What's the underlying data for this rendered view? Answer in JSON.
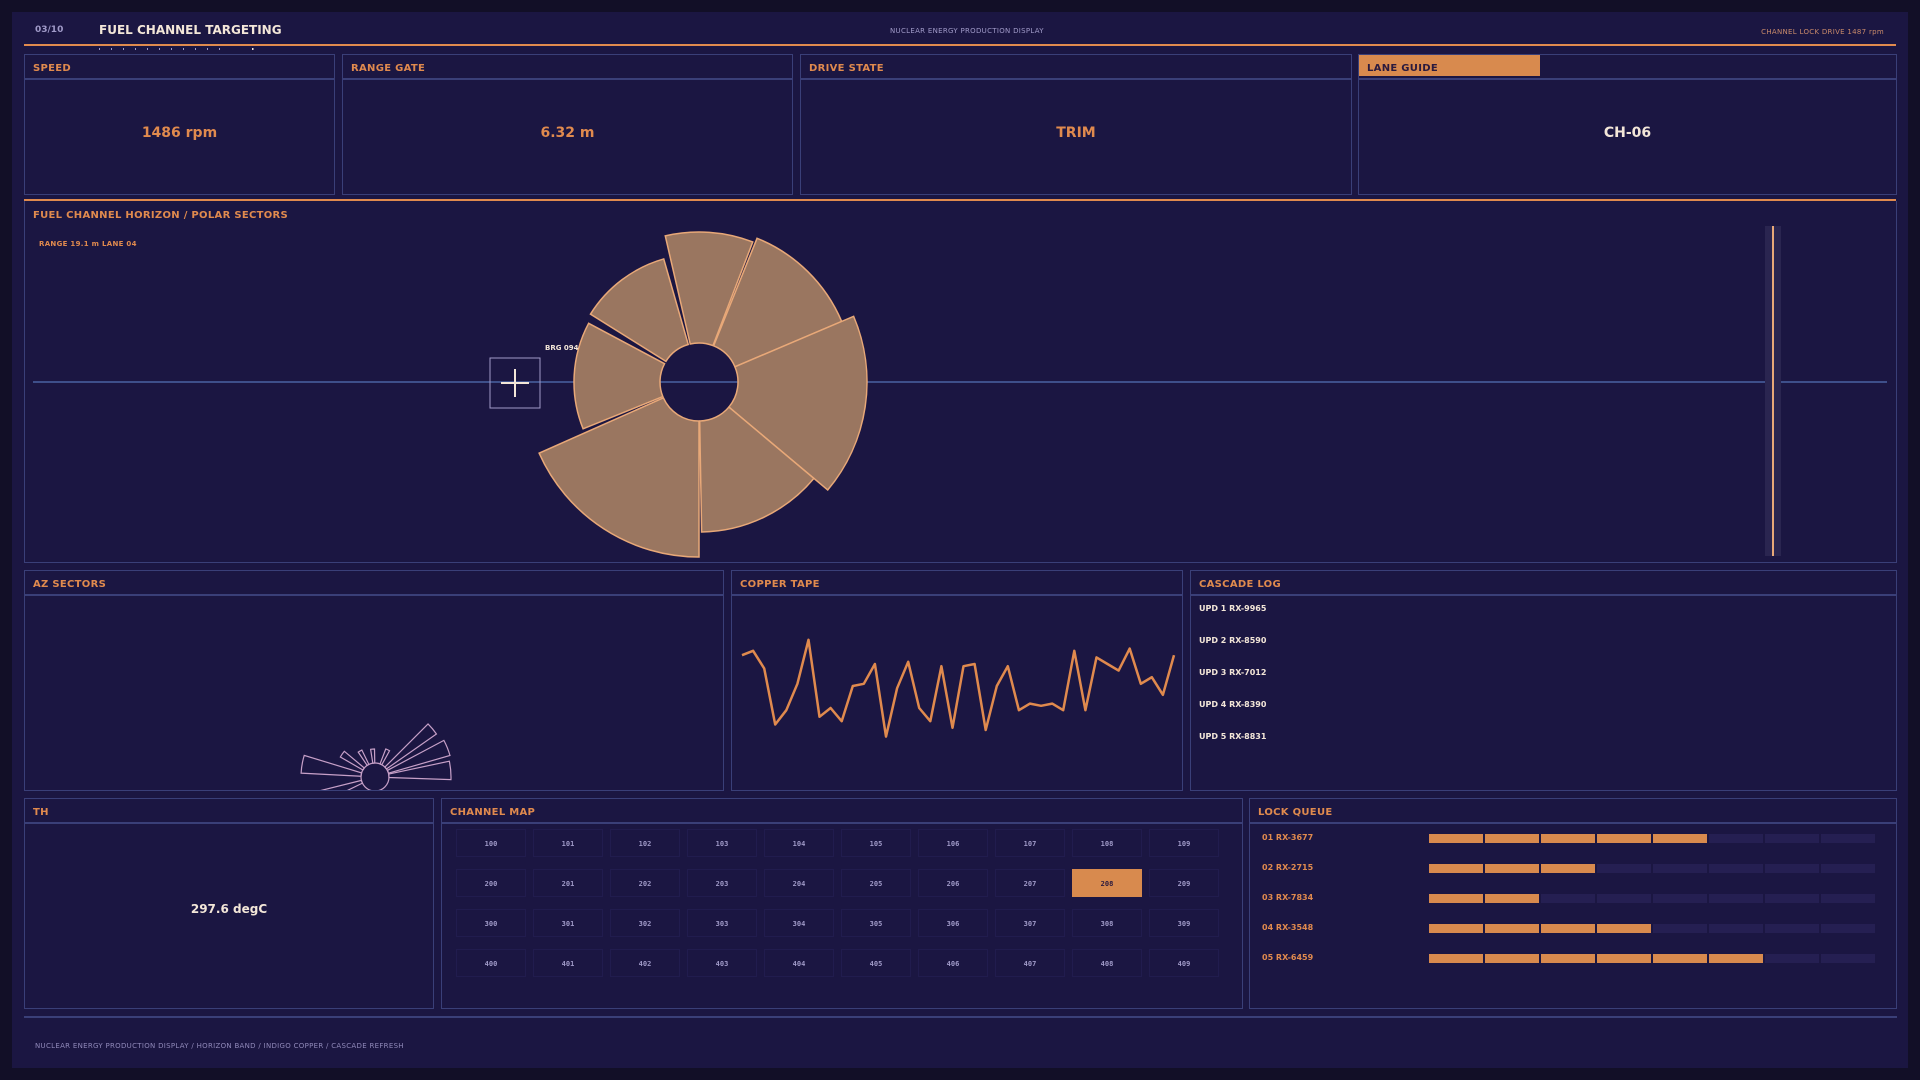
{
  "header": {
    "page_counter": "03/10",
    "title": "FUEL CHANNEL TARGETING",
    "subtitle": "NUCLEAR ENERGY PRODUCTION DISPLAY",
    "status": "CHANNEL LOCK  DRIVE 1487 rpm"
  },
  "stats": [
    {
      "label": "SPEED",
      "value": "1486 rpm",
      "color": "#e08a4e"
    },
    {
      "label": "RANGE GATE",
      "value": "6.32 m",
      "color": "#e08a4e"
    },
    {
      "label": "DRIVE STATE",
      "value": "TRIM",
      "color": "#e08a4e"
    },
    {
      "label": "LANE GUIDE",
      "value": "CH-06",
      "color": "#f3e6d8"
    }
  ],
  "horizon": {
    "title": "FUEL CHANNEL HORIZON  /  POLAR SECTORS",
    "range_readout": "RANGE 19.1 m  LANE 04",
    "bearing_label": "BRG 094"
  },
  "az_sectors": {
    "title": "AZ SECTORS"
  },
  "copper_tape": {
    "title": "COPPER TAPE",
    "values": [
      0.78,
      0.82,
      0.66,
      0.15,
      0.28,
      0.52,
      0.92,
      0.22,
      0.3,
      0.18,
      0.5,
      0.52,
      0.7,
      0.04,
      0.48,
      0.72,
      0.3,
      0.18,
      0.68,
      0.12,
      0.68,
      0.7,
      0.1,
      0.5,
      0.68,
      0.28,
      0.34,
      0.32,
      0.34,
      0.28,
      0.82,
      0.28,
      0.76,
      0.7,
      0.64,
      0.84,
      0.52,
      0.58,
      0.42,
      0.78
    ]
  },
  "cascade_log": {
    "title": "CASCADE LOG",
    "entries": [
      "UPD 1  RX-9965",
      "UPD 2  RX-8590",
      "UPD 3  RX-7012",
      "UPD 4  RX-8390",
      "UPD 5  RX-8831"
    ]
  },
  "th": {
    "title": "TH",
    "value": "297.6 degC"
  },
  "channel_map": {
    "title": "CHANNEL MAP",
    "rows": [
      [
        "100",
        "101",
        "102",
        "103",
        "104",
        "105",
        "106",
        "107",
        "108",
        "109"
      ],
      [
        "200",
        "201",
        "202",
        "203",
        "204",
        "205",
        "206",
        "207",
        "208",
        "209"
      ],
      [
        "300",
        "301",
        "302",
        "303",
        "304",
        "305",
        "306",
        "307",
        "308",
        "309"
      ],
      [
        "400",
        "401",
        "402",
        "403",
        "404",
        "405",
        "406",
        "407",
        "408",
        "409"
      ]
    ],
    "active": "208"
  },
  "lock_queue": {
    "title": "LOCK QUEUE",
    "items": [
      {
        "label": "01  RX-3677",
        "filled": 5,
        "total": 8
      },
      {
        "label": "02  RX-2715",
        "filled": 3,
        "total": 8
      },
      {
        "label": "03  RX-7834",
        "filled": 2,
        "total": 8
      },
      {
        "label": "04  RX-3548",
        "filled": 4,
        "total": 8
      },
      {
        "label": "05  RX-6459",
        "filled": 6,
        "total": 8
      }
    ]
  },
  "footer": {
    "text": "NUCLEAR ENERGY PRODUCTION DISPLAY  /  HORIZON BAND  /  INDIGO COPPER  /  CASCADE REFRESH"
  },
  "colors": {
    "accent": "#e08a4e",
    "background": "#1b1642",
    "border": "#3a3f78",
    "sector_fill": "#9a7660",
    "sector_stroke": "#e8a878"
  }
}
